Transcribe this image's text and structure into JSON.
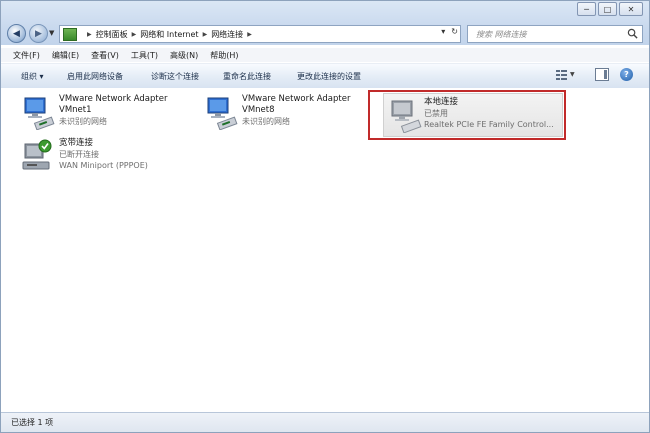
{
  "window": {
    "controls": {
      "minimize": "─",
      "maximize": "□",
      "close": "✕"
    }
  },
  "address": {
    "crumbs": [
      "控制面板",
      "网络和 Internet",
      "网络连接"
    ],
    "refresh_glyph": "↻",
    "dropdown_glyph": "▾"
  },
  "search": {
    "placeholder": "搜索 网络连接"
  },
  "menu": [
    "文件(F)",
    "编辑(E)",
    "查看(V)",
    "工具(T)",
    "高级(N)",
    "帮助(H)"
  ],
  "commands": {
    "organize": "组织 ▾",
    "enable_device": "启用此网络设备",
    "diagnose": "诊断这个连接",
    "rename": "重命名此连接",
    "change_settings": "更改此连接的设置"
  },
  "connections": [
    {
      "title": "VMware Network Adapter",
      "subtitle": "VMnet1",
      "status": "未识别的网络",
      "icon": "network-adapter-icon"
    },
    {
      "title": "VMware Network Adapter",
      "subtitle": "VMnet8",
      "status": "未识别的网络",
      "icon": "network-adapter-icon"
    },
    {
      "title": "本地连接",
      "subtitle": "已禁用",
      "status": "Realtek PCIe FE Family Control...",
      "icon": "network-adapter-disabled-icon"
    },
    {
      "title": "宽带连接",
      "subtitle": "已断开连接",
      "status": "WAN Miniport (PPPOE)",
      "icon": "broadband-connection-icon"
    }
  ],
  "statusbar": {
    "text": "已选择 1 项"
  },
  "colors": {
    "highlight": "#c12a2a",
    "toolbar_text": "#1c2f4a"
  }
}
